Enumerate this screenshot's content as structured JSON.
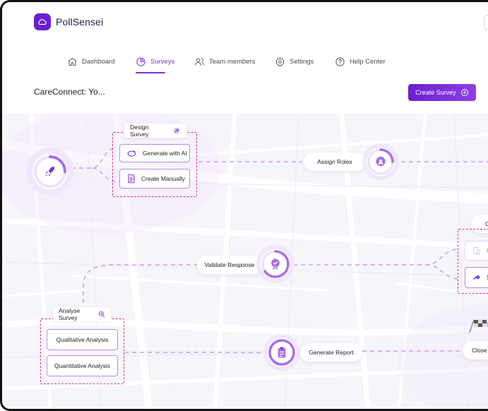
{
  "app": {
    "name": "PollSensei",
    "brand_color": "#6b1fd0"
  },
  "nav": {
    "items": [
      {
        "label": "Dashboard",
        "icon": "home-icon",
        "active": false
      },
      {
        "label": "Surveys",
        "icon": "pie-chart-icon",
        "active": true
      },
      {
        "label": "Team members",
        "icon": "users-icon",
        "active": false
      },
      {
        "label": "Settings",
        "icon": "gear-icon",
        "active": false
      },
      {
        "label": "Help Center",
        "icon": "help-circle-icon",
        "active": false
      }
    ]
  },
  "page": {
    "title": "CareConnect: Yo...",
    "create_button": "Create Survey",
    "create_icon": "plus-circle-icon"
  },
  "flow": {
    "accent": "#a86ee6",
    "dashed_border": "#d6348f",
    "start_node_icon": "rocket-icon",
    "design_survey": {
      "label": "Design Survey",
      "icon": "magic-icon",
      "options": [
        {
          "label": "Generate with AI",
          "icon": "ai-sparkle-icon"
        },
        {
          "label": "Create Manually",
          "icon": "document-icon"
        }
      ]
    },
    "assign_roles": {
      "label": "Assign Roles",
      "icon": "gear-user-icon"
    },
    "right_group": {
      "label": "C",
      "options": [
        {
          "label": "Bu",
          "icon": "building-icon"
        },
        {
          "label": "S",
          "icon": "share-icon"
        }
      ]
    },
    "validate_response": {
      "label": "Validate Response",
      "icon": "badge-check-icon"
    },
    "analyse_survey": {
      "label": "Analyse Survey",
      "icon": "magnify-chart-icon",
      "options": [
        {
          "label": "Qualitative Analysis"
        },
        {
          "label": "Quantitative Analysis"
        }
      ]
    },
    "generate_report": {
      "label": "Generate Report",
      "icon": "clipboard-icon"
    },
    "close_survey": {
      "label": "Close S",
      "icon": "checkered-flag-icon"
    }
  }
}
